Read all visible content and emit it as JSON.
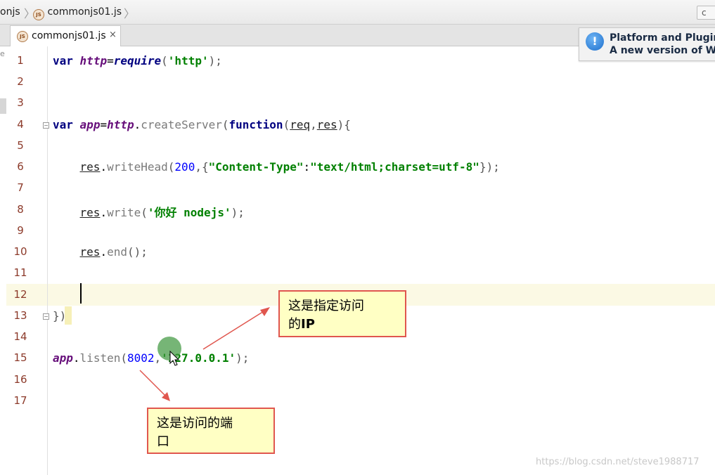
{
  "breadcrumb": {
    "items": [
      "onjs",
      "commonjs01.js"
    ],
    "right_button": "c"
  },
  "tab": {
    "icon_text": "JS",
    "label": "commonjs01.js",
    "close": "×"
  },
  "edge_letter": "e",
  "notification": {
    "title": "Platform and Plugin",
    "body": "A new version of We"
  },
  "editor": {
    "line_numbers": [
      "1",
      "2",
      "3",
      "4",
      "5",
      "6",
      "7",
      "8",
      "9",
      "10",
      "11",
      "12",
      "13",
      "14",
      "15",
      "16",
      "17"
    ],
    "current_line": "12",
    "code_lines": [
      "var http=require('http');",
      "",
      "",
      "var app=http.createServer(function(req,res){",
      "",
      "    res.writeHead(200,{\"Content-Type\":\"text/html;charset=utf-8\"});",
      "",
      "    res.write('你好 nodejs');",
      "",
      "    res.end();",
      "",
      "",
      "})",
      "",
      "app.listen(8002,'127.0.0.1');",
      "",
      ""
    ]
  },
  "annotations": {
    "ip": {
      "line1": "这是指定访问",
      "line2_a": "的",
      "line2_b": "IP"
    },
    "port": {
      "line1": "这是访问的端",
      "line2": "口"
    }
  },
  "watermark": "https://blog.csdn.net/steve1988717",
  "colors": {
    "keyword": "#000080",
    "variable": "#660e7a",
    "string": "#008000",
    "number": "#0000ff",
    "line_number": "#8c3a2a",
    "annotation_border": "#e0564e",
    "annotation_bg": "#ffffc4"
  }
}
